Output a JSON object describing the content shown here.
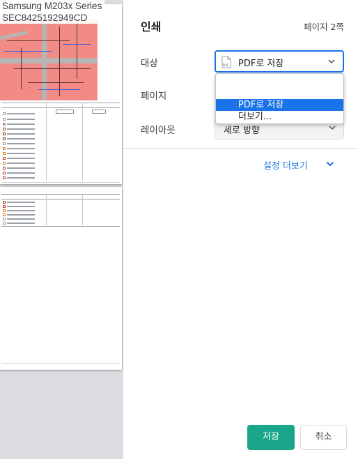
{
  "window": {
    "title": "인쇄"
  },
  "preview": {
    "printer_line1": "Samsung M203x Series",
    "printer_line2": "SEC8425192949CD",
    "page_count": 2
  },
  "header": {
    "title": "인쇄",
    "page_count": "페이지 2쪽"
  },
  "settings": {
    "destination": {
      "label": "대상",
      "value": "PDF로 저장",
      "icon": "pdf-file-icon"
    },
    "pages": {
      "label": "페이지"
    },
    "layout": {
      "label": "레이아웃",
      "value": "세로 방향"
    }
  },
  "dropdown": {
    "items": [
      {
        "label": ""
      },
      {
        "label": "PDF로 저장",
        "selected": true
      },
      {
        "label": "더보기..."
      }
    ]
  },
  "more_settings": {
    "label": "설정 더보기"
  },
  "footer": {
    "save_label": "저장",
    "cancel_label": "취소"
  },
  "colors": {
    "accent": "#1a73e8",
    "save_button": "#1aa68a",
    "map_overlay": "#f28b86",
    "preview_bg": "#dadce0"
  }
}
